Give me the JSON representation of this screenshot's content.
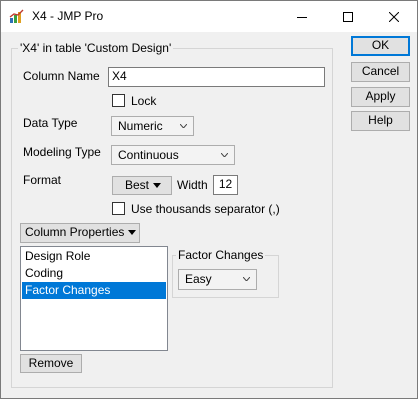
{
  "window": {
    "title": "X4 - JMP Pro"
  },
  "group": {
    "legend": "'X4' in table 'Custom Design'"
  },
  "column_name": {
    "label": "Column Name",
    "value": "X4"
  },
  "lock": {
    "label": "Lock",
    "checked": false
  },
  "data_type": {
    "label": "Data Type",
    "value": "Numeric"
  },
  "modeling_type": {
    "label": "Modeling Type",
    "value": "Continuous"
  },
  "format": {
    "label": "Format",
    "value": "Best",
    "width_label": "Width",
    "width_value": "12"
  },
  "thousands": {
    "label": "Use thousands separator (,)",
    "checked": false
  },
  "column_properties": {
    "button_label": "Column Properties",
    "items": [
      {
        "label": "Design Role",
        "selected": false
      },
      {
        "label": "Coding",
        "selected": false
      },
      {
        "label": "Factor Changes",
        "selected": true
      }
    ],
    "remove_label": "Remove"
  },
  "factor_changes": {
    "legend": "Factor Changes",
    "value": "Easy"
  },
  "buttons": {
    "ok": "OK",
    "cancel": "Cancel",
    "apply": "Apply",
    "help": "Help"
  },
  "colors": {
    "selection": "#0078d7",
    "window_bg": "#f0f0f0"
  }
}
